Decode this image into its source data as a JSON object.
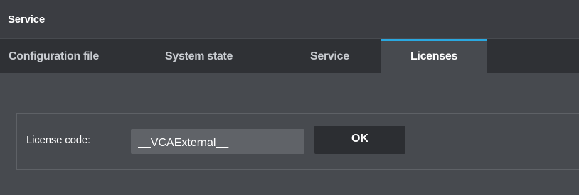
{
  "header": {
    "title": "Service"
  },
  "tabs": [
    {
      "label": "Configuration file",
      "active": false
    },
    {
      "label": "System state",
      "active": false
    },
    {
      "label": "Service",
      "active": false
    },
    {
      "label": "Licenses",
      "active": true
    }
  ],
  "license_form": {
    "label": "License code:",
    "value": "__VCAExternal__",
    "ok_label": "OK"
  },
  "colors": {
    "accent": "#2aa8e0",
    "background": "#474a4f",
    "header": "#3b3d42",
    "tab_bar": "#2f3135"
  }
}
